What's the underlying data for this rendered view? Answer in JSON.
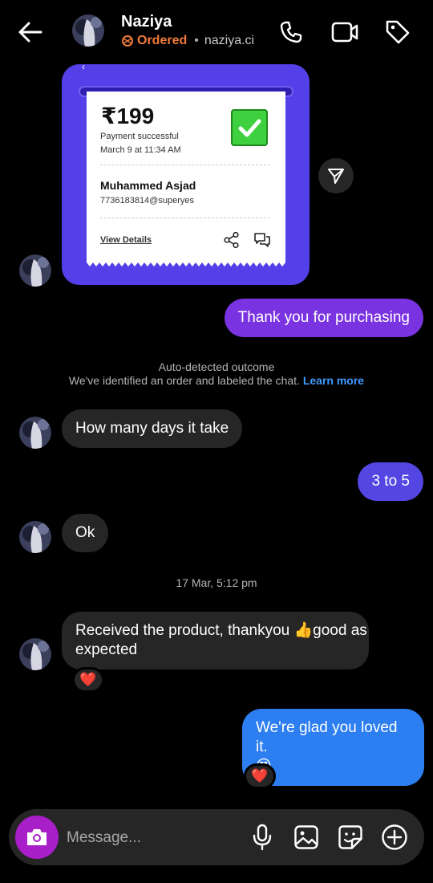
{
  "header": {
    "name": "Naziya",
    "status": "Ordered",
    "handle": "naziya.ci"
  },
  "receipt": {
    "amount": "₹199",
    "status": "Payment successful",
    "date": "March 9 at 11:34 AM",
    "payer_name": "Muhammed Asjad",
    "payer_upi": "7736183814@superyes",
    "view_details": "View Details"
  },
  "messages": {
    "thank_you": "Thank you for purchasing",
    "auto_title": "Auto-detected outcome",
    "auto_body": "We've identified an order and labeled the chat.",
    "learn_more": "Learn more",
    "how_many": "How many days it take",
    "three_to_five": "3 to 5",
    "ok": "Ok",
    "timestamp": "17 Mar, 5:12 pm",
    "received_1": "Received the product, thankyou 👍good as",
    "received_2": "expected",
    "glad_1": "We're glad you loved it.",
    "glad_2": "😍",
    "reaction": "❤️"
  },
  "composer": {
    "placeholder": "Message..."
  },
  "colors": {
    "card": "#5340e8",
    "ordered": "#f07a3a",
    "learn_more": "#3f9bff",
    "camera": "#a81ec8"
  }
}
